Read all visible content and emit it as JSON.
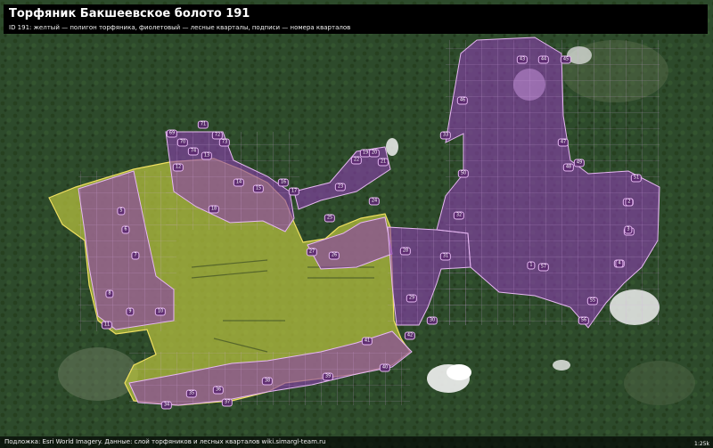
{
  "header": {
    "title": "Торфяник Бакшеевское болото 191",
    "subtitle": "ID 191: желтый — полигон торфяника, фиолетовый — лесные кварталы, подписи — номера кварталов"
  },
  "footer": {
    "attribution": "Подложка: Esri World Imagery. Данные: слой торфяников и лесных кварталов wiki.simargl-team.ru",
    "scale_text": "1:25k"
  },
  "legend_colors": {
    "peat_polygon": "#c9d14a",
    "peat_outline": "#f0e060",
    "forest_quarters": "#9a4fbf",
    "quarter_outline": "#e6b8f2",
    "background_forest": "#2f4a2c"
  },
  "quarter_labels": [
    "69",
    "70",
    "71",
    "72",
    "73",
    "74",
    "5",
    "6",
    "7",
    "8",
    "9",
    "10",
    "11",
    "12",
    "13",
    "14",
    "15",
    "16",
    "17",
    "18",
    "19",
    "20",
    "21",
    "22",
    "23",
    "24",
    "25",
    "26",
    "27",
    "28",
    "29",
    "30",
    "31",
    "32",
    "33",
    "34",
    "35",
    "36",
    "37",
    "38",
    "39",
    "40",
    "41",
    "42",
    "43",
    "44",
    "45",
    "46",
    "47",
    "48",
    "49",
    "50",
    "51",
    "52",
    "53",
    "54",
    "55",
    "56",
    "57",
    "1",
    "2",
    "3",
    "4"
  ]
}
